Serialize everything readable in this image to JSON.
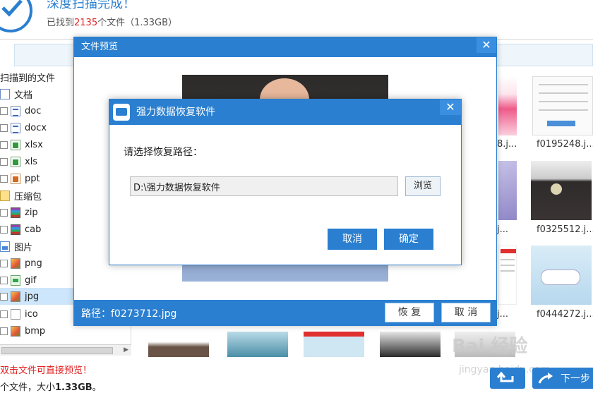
{
  "header": {
    "title": "深度扫描完成！",
    "stats_prefix": "已找到",
    "file_count": "2135",
    "stats_suffix": "个文件（1.33GB）"
  },
  "tree": {
    "root_label": "扫描到的文件",
    "items": [
      {
        "label": "文档",
        "icon": "document-folder-icon",
        "level": 0
      },
      {
        "label": "doc",
        "icon": "word-file-icon",
        "level": 1
      },
      {
        "label": "docx",
        "icon": "word-file-icon",
        "level": 1
      },
      {
        "label": "xlsx",
        "icon": "excel-file-icon",
        "level": 1
      },
      {
        "label": "xls",
        "icon": "excel-file-icon",
        "level": 1
      },
      {
        "label": "ppt",
        "icon": "powerpoint-file-icon",
        "level": 1
      },
      {
        "label": "压缩包",
        "icon": "archive-folder-icon",
        "level": 0
      },
      {
        "label": "zip",
        "icon": "archive-file-icon",
        "level": 1
      },
      {
        "label": "cab",
        "icon": "archive-file-icon",
        "level": 1
      },
      {
        "label": "图片",
        "icon": "image-folder-icon",
        "level": 0
      },
      {
        "label": "png",
        "icon": "image-file-icon",
        "level": 1
      },
      {
        "label": "gif",
        "icon": "gif-file-icon",
        "level": 1
      },
      {
        "label": "jpg",
        "icon": "image-file-icon",
        "level": 1,
        "selected": true
      },
      {
        "label": "ico",
        "icon": "blank-file-icon",
        "level": 1
      },
      {
        "label": "bmp",
        "icon": "image-file-icon",
        "level": 1
      }
    ]
  },
  "thumbnails": {
    "labels": [
      "8.j...",
      "f0195248.j...",
      "j...",
      "f0325512.j...",
      "j...",
      "f0444272.j..."
    ]
  },
  "footer": {
    "hint": "双击文件可直接预览！",
    "summary_prefix": "个文件，大小",
    "summary_size": "1.33GB",
    "summary_suffix": "。",
    "next_label": "下一步",
    "watermark": "Bai 经验",
    "watermark_sub": "jingyan.baidu.com"
  },
  "preview": {
    "title": "文件预览",
    "close": "✕",
    "path_label": "路径：f0273712.jpg",
    "restore_label": "恢 复",
    "cancel_label": "取 消"
  },
  "modal": {
    "title": "强力数据恢复软件",
    "close": "✕",
    "prompt": "请选择恢复路径：",
    "path_value": "D:\\强力数据恢复软件",
    "browse_label": "浏览",
    "cancel_label": "取消",
    "confirm_label": "确定"
  },
  "colors": {
    "accent": "#2a7fd0",
    "highlight": "#e02020",
    "selection": "#cde6fb"
  }
}
